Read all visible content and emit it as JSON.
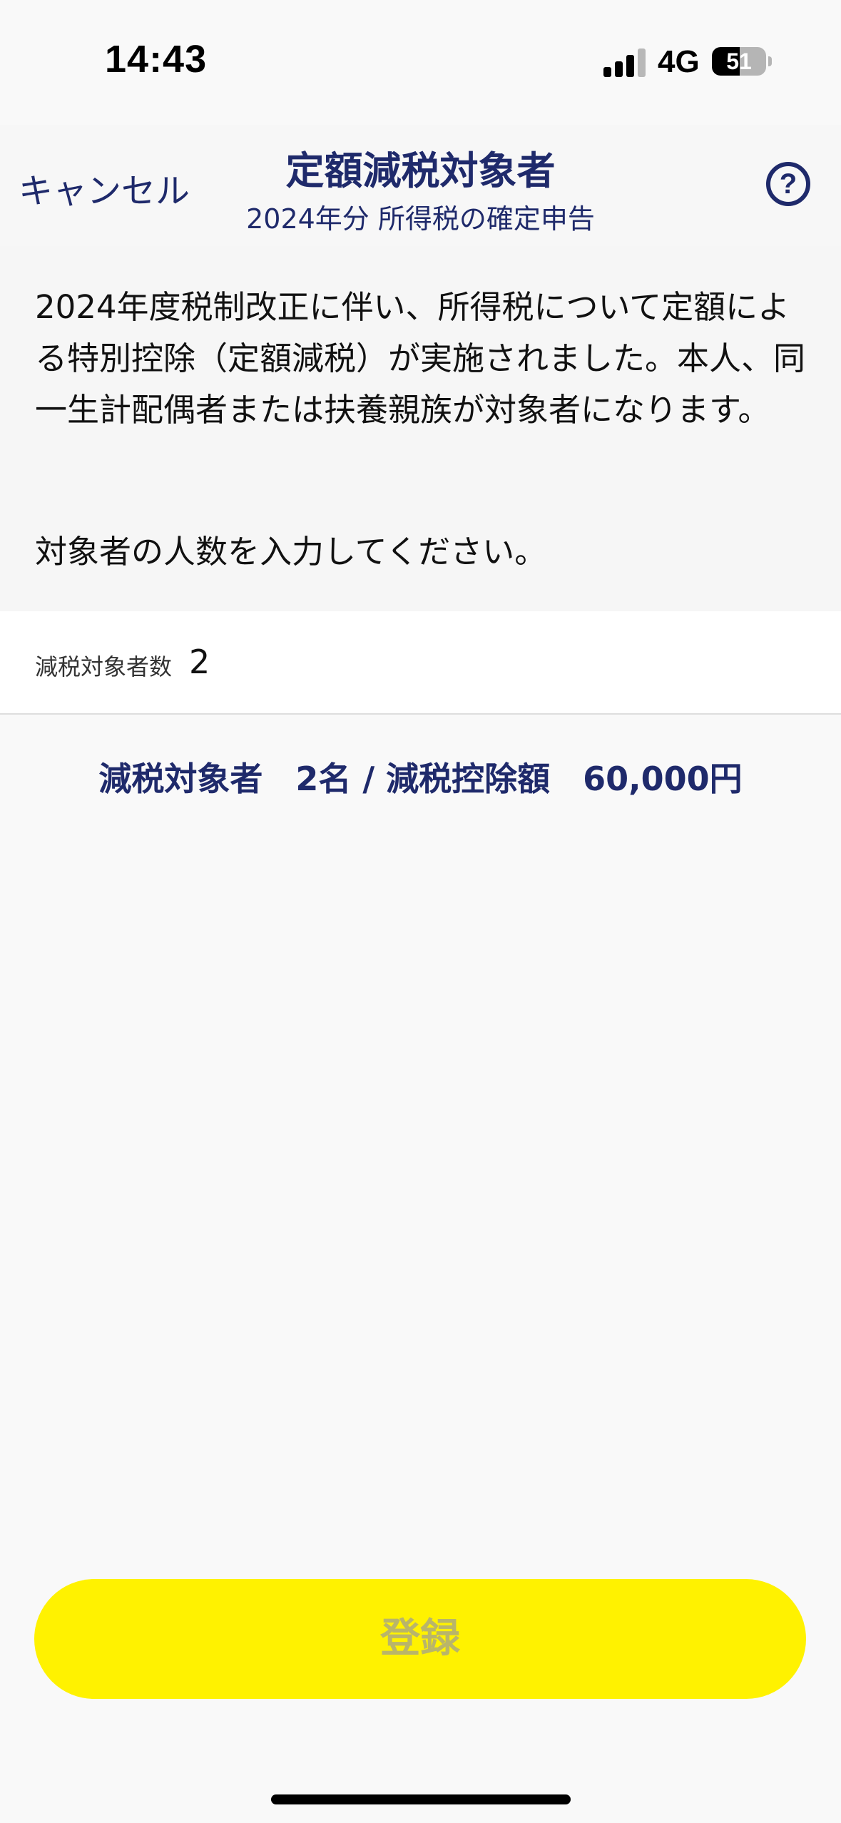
{
  "status_bar": {
    "time": "14:43",
    "network": "4G",
    "battery": "51",
    "battery_level_percent": 51
  },
  "nav": {
    "cancel_label": "キャンセル",
    "title": "定額減税対象者",
    "subtitle": "2024年分 所得税の確定申告",
    "help_label": "?"
  },
  "info": {
    "description": "2024年度税制改正に伴い、所得税について定額による特別控除（定額減税）が実施されました。本人、同一生計配偶者または扶養親族が対象者になります。",
    "instruction": "対象者の人数を入力してください。"
  },
  "count_field": {
    "label": "減税対象者数",
    "value": "2"
  },
  "summary": {
    "text": "減税対象者　2名 / 減税控除額　60,000円"
  },
  "register_button": {
    "label": "登録"
  },
  "colors": {
    "accent": "#1f2a6b",
    "button": "#fff200",
    "button_text_disabled": "#b9b56a"
  }
}
